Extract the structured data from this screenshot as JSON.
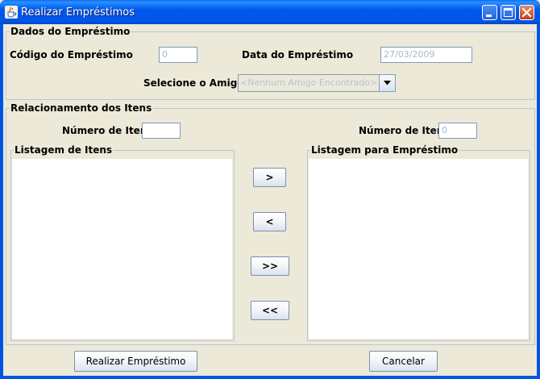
{
  "window": {
    "title": "Realizar Empréstimos",
    "icon": "java-cup-icon"
  },
  "dados": {
    "legend": "Dados do Empréstimo",
    "codigo_label": "Código do Empréstimo",
    "codigo_value": "0",
    "data_label": "Data do Empréstimo",
    "data_value": "27/03/2009",
    "amigo_label": "Selecione o Amigo",
    "amigo_value": "<Nenhum Amigo Encontrado>"
  },
  "relacionamento": {
    "legend": "Relacionamento dos Itens",
    "num_itens_left_label": "Número de Itens",
    "num_itens_left_value": "",
    "num_itens_right_label": "Número de Itens",
    "num_itens_right_value": "0",
    "listagem_itens_legend": "Listagem de Itens",
    "listagem_emprestimo_legend": "Listagem para Empréstimo",
    "btn_move_right": ">",
    "btn_move_left": "<",
    "btn_move_all_right": ">>",
    "btn_move_all_left": "<<"
  },
  "footer": {
    "realizar_label": "Realizar Empréstimo",
    "cancelar_label": "Cancelar"
  }
}
